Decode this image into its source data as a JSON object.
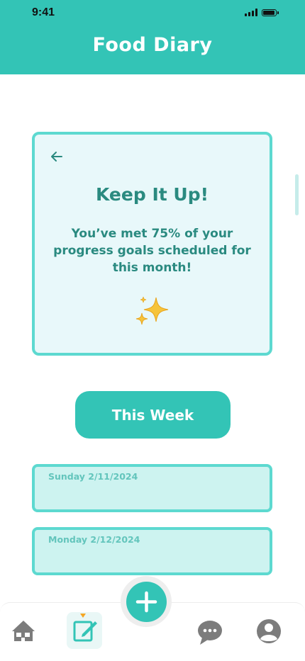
{
  "status_bar": {
    "time": "9:41"
  },
  "header": {
    "title": "Food Diary"
  },
  "card": {
    "title": "Keep It Up!",
    "message": "You’ve met 75% of your progress goals scheduled for this month!",
    "icon": "sparkles-icon"
  },
  "week_button": {
    "label": "This Week"
  },
  "days": [
    {
      "label": "Sunday 2/11/2024"
    },
    {
      "label": "Monday 2/12/2024"
    }
  ],
  "nav": {
    "items": [
      "home-icon",
      "diary-edit-icon",
      "chat-icon",
      "profile-icon"
    ],
    "active": "diary-edit-icon",
    "fab": "plus-icon"
  },
  "colors": {
    "primary": "#33c4b6",
    "card_border": "#5dd9d0",
    "card_bg": "#e8f8fa",
    "text": "#2a8a80",
    "accent": "#f5a623"
  }
}
